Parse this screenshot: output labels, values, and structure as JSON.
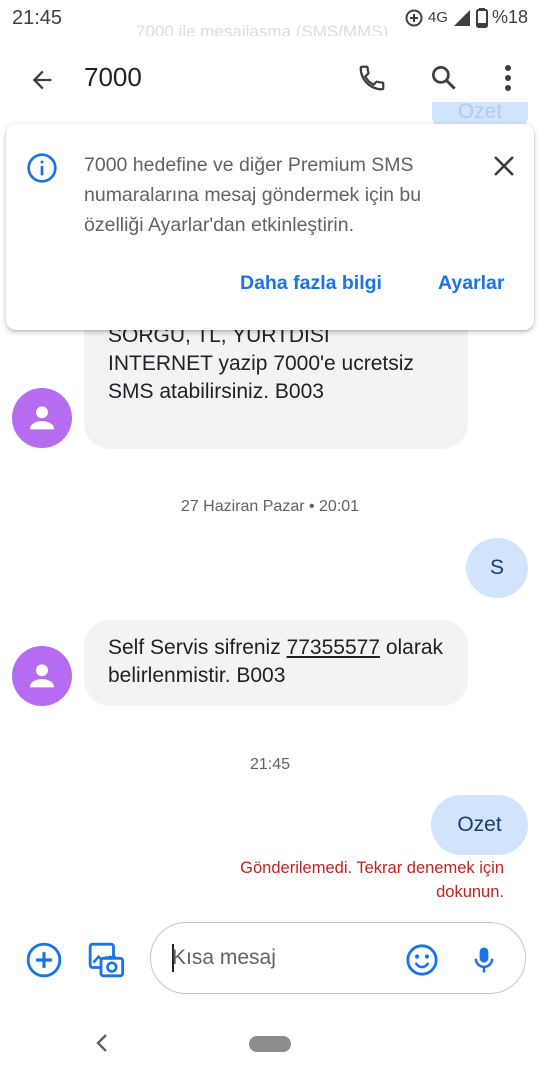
{
  "status_bar": {
    "time": "21:45",
    "network": "4G",
    "battery": "%18"
  },
  "background_title": "7000 ile mesajlaşma (SMS/MMS)",
  "app_bar": {
    "title": "7000",
    "icons": [
      "back-arrow-icon",
      "phone-icon",
      "search-icon",
      "more-vert-icon"
    ]
  },
  "info_card": {
    "text": "7000 hedefine ve diğer Premium SMS numaralarına mesaj göndermek için bu özelliği Ayarlar'dan etkinleştirin.",
    "learn_more": "Daha fazla bilgi",
    "settings": "Ayarlar"
  },
  "messages": {
    "first": {
      "partial_line": "SORGU, TL, YURTDISI",
      "body": "INTERNET yazip 7000'e ucretsiz SMS atabilirsiniz. B003"
    },
    "date_1": "27 Haziran Pazar • 20:01",
    "outgoing_1": "S",
    "second": {
      "prefix": "Self Servis sifreniz ",
      "code": "77355577",
      "suffix": " olarak belirlenmistir. B003"
    },
    "date_2": "21:45",
    "outgoing_2": "Ozet",
    "error": "Gönderilemedi. Tekrar denemek için dokunun."
  },
  "composer": {
    "placeholder": "Kısa mesaj"
  },
  "colors": {
    "accent": "#1a73e8",
    "avatar": "#b56cf0",
    "outgoing_bubble": "#d2e3fc",
    "incoming_bubble": "#f1f3f4",
    "error": "#c5221f"
  }
}
